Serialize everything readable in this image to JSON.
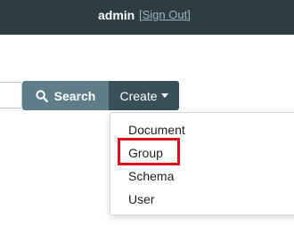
{
  "header": {
    "username": "admin",
    "sign_out_label": "[Sign Out]"
  },
  "toolbar": {
    "search_label": "Search",
    "create_label": "Create"
  },
  "create_menu": {
    "items": [
      {
        "label": "Document"
      },
      {
        "label": "Group"
      },
      {
        "label": "Schema"
      },
      {
        "label": "User"
      }
    ],
    "highlighted_index": 1
  },
  "colors": {
    "topbar": "#2c3e44",
    "search_button": "#5c7d89",
    "create_button": "#37505a",
    "highlight": "#e0111c"
  },
  "icons": {
    "search": "search-icon",
    "caret": "caret-down-icon"
  }
}
